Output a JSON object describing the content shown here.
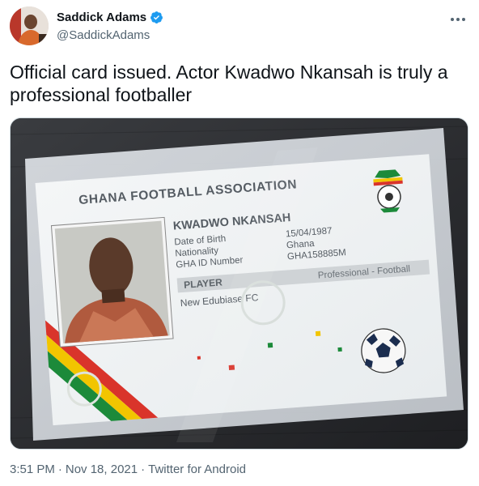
{
  "author": {
    "name": "Saddick Adams",
    "handle": "@SaddickAdams",
    "verified_color": "#1d9bf0"
  },
  "tweet": {
    "text": "Official card issued. Actor Kwadwo Nkansah is truly a professional footballer"
  },
  "card": {
    "association": "GHANA FOOTBALL ASSOCIATION",
    "name": "KWADWO NKANSAH",
    "fields": [
      {
        "label": "Date of Birth",
        "value": "15/04/1987"
      },
      {
        "label": "Nationality",
        "value": "Ghana"
      },
      {
        "label": "GHA ID Number",
        "value": "GHA158885M"
      }
    ],
    "role": "PLAYER",
    "category": "Professional - Football",
    "club": "New Edubiase FC"
  },
  "meta": {
    "time": "3:51 PM",
    "separator": "·",
    "date": "Nov 18, 2021",
    "source": "Twitter for Android"
  },
  "colors": {
    "text_primary": "#0f1419",
    "text_secondary": "#536471",
    "border": "#cfd9de"
  }
}
